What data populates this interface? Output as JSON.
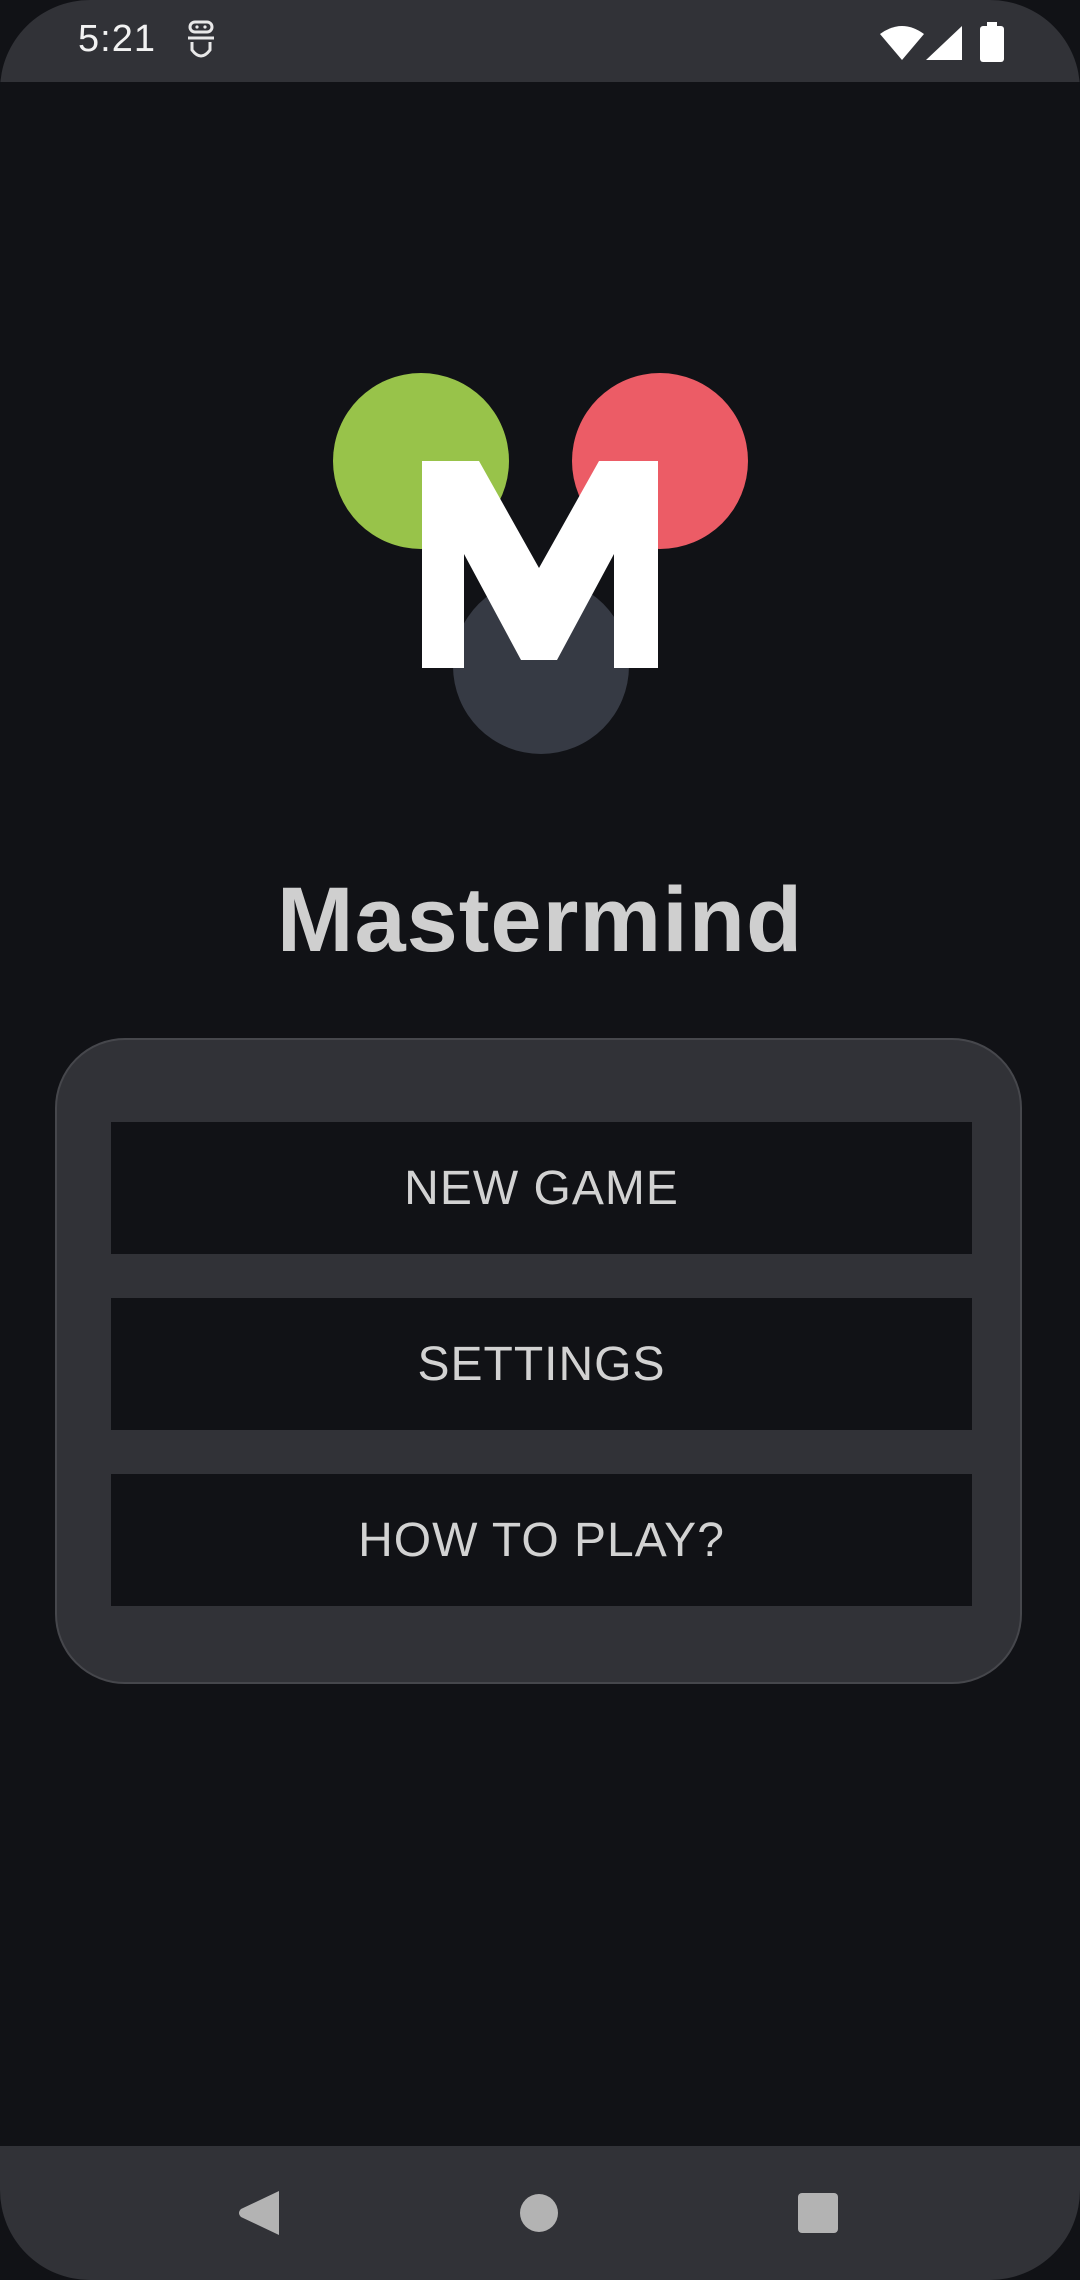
{
  "status_bar": {
    "time": "5:21",
    "icons": [
      "app-notification-icon",
      "wifi-icon",
      "signal-icon",
      "battery-icon"
    ]
  },
  "logo": {
    "letter": "M",
    "colors": {
      "left_circle": "#98c34a",
      "right_circle": "#ec5c66",
      "bottom_circle": "#363a44",
      "letter": "#ffffff"
    }
  },
  "app_title": "Mastermind",
  "menu": {
    "items": [
      {
        "label": "NEW GAME"
      },
      {
        "label": "SETTINGS"
      },
      {
        "label": "HOW TO PLAY?"
      }
    ]
  },
  "nav_bar": {
    "icons": [
      "back-icon",
      "home-icon",
      "recents-icon"
    ]
  },
  "colors": {
    "background": "#111216",
    "surface": "#313237",
    "text": "#d2d2d2"
  }
}
